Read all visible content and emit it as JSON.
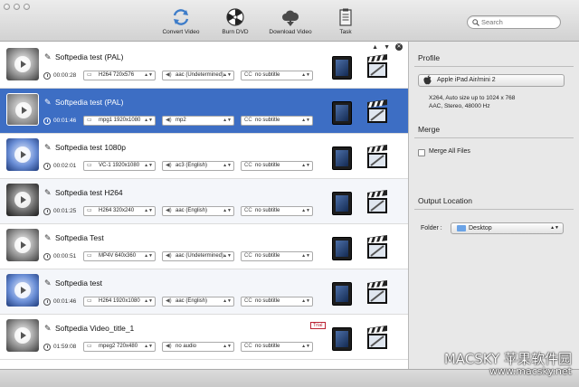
{
  "toolbar": {
    "convert": "Convert Video",
    "burn": "Burn DVD",
    "download": "Download Video",
    "task": "Task",
    "search_placeholder": "Search"
  },
  "list": {
    "rows": [
      {
        "title": "Softpedia test (PAL)",
        "duration": "00:00:28",
        "codec": "H264 720x576",
        "audio": "aac (Undetermined)",
        "subtitle": "no subtitle"
      },
      {
        "title": "Softpedia test (PAL)",
        "duration": "00:01:46",
        "codec": "mpg1 1920x1080",
        "audio": "mp2",
        "subtitle": "no subtitle"
      },
      {
        "title": "Softpedia test 1080p",
        "duration": "00:02:01",
        "codec": "VC-1 1920x1080",
        "audio": "ac3 (English)",
        "subtitle": "no subtitle"
      },
      {
        "title": "Softpedia test H264",
        "duration": "00:01:25",
        "codec": "H264 320x240",
        "audio": "aac (English)",
        "subtitle": "no subtitle"
      },
      {
        "title": "Softpedia Test",
        "duration": "00:00:51",
        "codec": "MP4V 640x360",
        "audio": "aac (Undetermined)",
        "subtitle": "no subtitle"
      },
      {
        "title": "Softpedia test",
        "duration": "00:01:46",
        "codec": "H264 1920x1080",
        "audio": "aac (English)",
        "subtitle": "no subtitle"
      },
      {
        "title": "Softpedia Video_title_1",
        "duration": "01:59:08",
        "codec": "mpeg2 720x480",
        "audio": "no audio",
        "subtitle": "no subtitle",
        "badge": "Trial"
      }
    ],
    "subtitle_lead": "CC",
    "up": "▲",
    "down": "▼",
    "remove": "✕"
  },
  "panel": {
    "profile_heading": "Profile",
    "profile_value": "Apple iPad Air/mini 2",
    "profile_line1": "X264, Auto size up to 1024 x 768",
    "profile_line2": "AAC, Stereo, 48000 Hz",
    "merge_heading": "Merge",
    "merge_label": "Merge All Files",
    "output_heading": "Output Location",
    "folder_label": "Folder :",
    "folder_value": "Desktop"
  },
  "watermark": {
    "brand": "MACSKY 苹果软件园",
    "url": "www.macsky.net"
  },
  "colors": {
    "selection": "#3d6ec4",
    "trial": "#bb2233"
  }
}
